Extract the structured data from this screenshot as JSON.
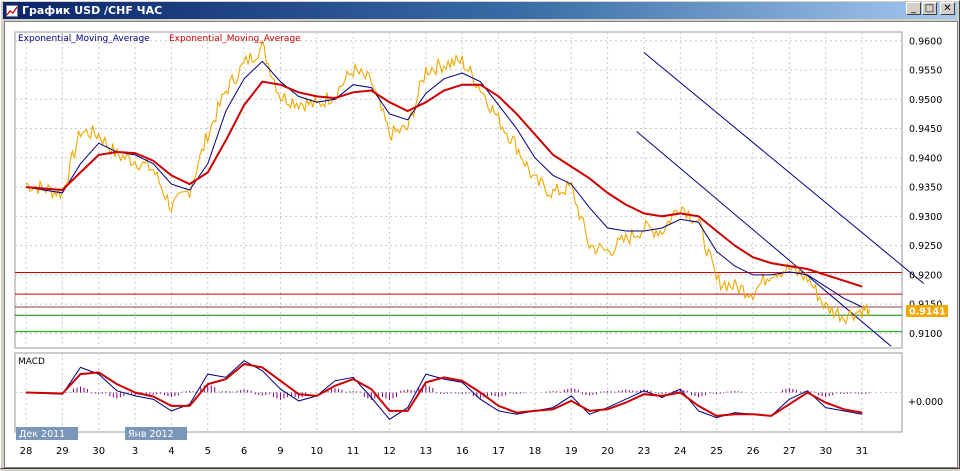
{
  "window": {
    "title": "График USD /CHF  ЧАС",
    "buttons": {
      "minimize": "_",
      "maximize": "□",
      "close": "✕"
    },
    "icon": "chart-window-icon"
  },
  "chart_data": {
    "type": "line",
    "title": "",
    "legend": [
      {
        "name": "Exponential_Moving_Average",
        "color": "#000080"
      },
      {
        "name": "Exponential_Moving_Average",
        "color": "#cc0000"
      }
    ],
    "price_axis": {
      "ticks": [
        "0.9600",
        "0.9550",
        "0.9500",
        "0.9450",
        "0.9400",
        "0.9350",
        "0.9300",
        "0.9250",
        "0.9200",
        "0.9150",
        "0.9100"
      ],
      "ylim": [
        0.9075,
        0.9615
      ],
      "current_price": "0.9141"
    },
    "date_axis": {
      "ticks": [
        "28",
        "29",
        "30",
        "3",
        "4",
        "5",
        "6",
        "9",
        "10",
        "11",
        "12",
        "13",
        "16",
        "17",
        "18",
        "19",
        "20",
        "23",
        "24",
        "25",
        "26",
        "27",
        "30",
        "31"
      ],
      "period_labels": [
        {
          "text": "Дек 2011",
          "at_tick": "28"
        },
        {
          "text": "Янв 2012",
          "at_tick": "3"
        }
      ]
    },
    "price_series": {
      "name": "USD/CHF",
      "color": "#f0a800",
      "x": [
        0,
        1,
        1.5,
        2,
        2.5,
        3,
        3.5,
        4,
        4.5,
        5,
        5.5,
        6,
        6.5,
        7,
        7.5,
        8,
        8.5,
        9,
        9.5,
        10,
        10.5,
        11,
        11.5,
        12,
        12.5,
        13,
        13.5,
        14,
        14.5,
        15,
        15.5,
        16,
        16.5,
        17,
        17.5,
        18,
        18.5,
        19,
        19.5,
        20,
        20.5,
        21,
        21.5,
        22,
        22.5,
        23,
        23.2
      ],
      "y": [
        0.9355,
        0.934,
        0.9445,
        0.944,
        0.9405,
        0.9395,
        0.938,
        0.9315,
        0.9345,
        0.944,
        0.9515,
        0.956,
        0.959,
        0.9505,
        0.9495,
        0.949,
        0.951,
        0.955,
        0.953,
        0.944,
        0.945,
        0.955,
        0.956,
        0.9565,
        0.952,
        0.9465,
        0.942,
        0.936,
        0.934,
        0.935,
        0.925,
        0.924,
        0.926,
        0.928,
        0.9275,
        0.932,
        0.929,
        0.919,
        0.918,
        0.917,
        0.9205,
        0.921,
        0.9195,
        0.9145,
        0.913,
        0.914,
        0.9141
      ]
    },
    "ema_fast": {
      "name": "Exponential_Moving_Average",
      "color": "#000080",
      "x": [
        0,
        1,
        1.5,
        2,
        2.5,
        3,
        3.5,
        4,
        4.5,
        5,
        5.5,
        6,
        6.5,
        7,
        7.5,
        8,
        8.5,
        9,
        9.5,
        10,
        10.5,
        11,
        11.5,
        12,
        12.5,
        13,
        13.5,
        14,
        14.5,
        15,
        15.5,
        16,
        16.5,
        17,
        17.5,
        18,
        18.5,
        19,
        19.5,
        20,
        20.5,
        21,
        21.5,
        22,
        22.5,
        23
      ],
      "y": [
        0.935,
        0.934,
        0.939,
        0.9425,
        0.941,
        0.9405,
        0.939,
        0.9355,
        0.9345,
        0.939,
        0.948,
        0.9535,
        0.9565,
        0.953,
        0.9505,
        0.9495,
        0.95,
        0.9525,
        0.952,
        0.9475,
        0.9465,
        0.951,
        0.9535,
        0.9545,
        0.953,
        0.949,
        0.945,
        0.94,
        0.937,
        0.9355,
        0.9315,
        0.928,
        0.9275,
        0.9275,
        0.928,
        0.9295,
        0.929,
        0.924,
        0.9215,
        0.92,
        0.92,
        0.9205,
        0.92,
        0.918,
        0.916,
        0.9145
      ]
    },
    "ema_slow": {
      "name": "Exponential_Moving_Average",
      "color": "#cc0000",
      "x": [
        0,
        1,
        1.5,
        2,
        2.5,
        3,
        3.5,
        4,
        4.5,
        5,
        5.5,
        6,
        6.5,
        7,
        7.5,
        8,
        8.5,
        9,
        9.5,
        10,
        10.5,
        11,
        11.5,
        12,
        12.5,
        13,
        13.5,
        14,
        14.5,
        15,
        15.5,
        16,
        16.5,
        17,
        17.5,
        18,
        18.5,
        19,
        19.5,
        20,
        20.5,
        21,
        21.5,
        22,
        22.5,
        23
      ],
      "y": [
        0.935,
        0.9345,
        0.9375,
        0.9405,
        0.941,
        0.9408,
        0.9395,
        0.937,
        0.9355,
        0.9375,
        0.943,
        0.949,
        0.953,
        0.9525,
        0.9512,
        0.9505,
        0.9502,
        0.9512,
        0.9515,
        0.9495,
        0.948,
        0.9495,
        0.9515,
        0.9525,
        0.9525,
        0.9505,
        0.9475,
        0.944,
        0.9405,
        0.9385,
        0.9365,
        0.934,
        0.932,
        0.9305,
        0.93,
        0.9305,
        0.93,
        0.9275,
        0.925,
        0.923,
        0.922,
        0.9215,
        0.921,
        0.92,
        0.919,
        0.918
      ]
    },
    "horizontal_levels": [
      {
        "value": 0.9204,
        "color": "#cc0000"
      },
      {
        "value": 0.9167,
        "color": "#cc0000"
      },
      {
        "value": 0.9145,
        "color": "#884444"
      },
      {
        "value": 0.9131,
        "color": "#008800"
      },
      {
        "value": 0.9103,
        "color": "#00aa00"
      }
    ],
    "channel_lines": [
      {
        "color": "#000080",
        "x": [
          17,
          24.7
        ],
        "y": [
          0.958,
          0.9185
        ]
      },
      {
        "color": "#000080",
        "x": [
          16.8,
          23.8
        ],
        "y": [
          0.9445,
          0.9078
        ]
      }
    ],
    "macd": {
      "label": "MACD",
      "zero_label": "+0.000",
      "ylim": [
        -1,
        1
      ],
      "x": [
        0,
        1,
        1.5,
        2,
        2.5,
        3,
        3.5,
        4,
        4.5,
        5,
        5.5,
        6,
        6.5,
        7,
        7.5,
        8,
        8.5,
        9,
        9.5,
        10,
        10.5,
        11,
        11.5,
        12,
        12.5,
        13,
        13.5,
        14,
        14.5,
        15,
        15.5,
        16,
        16.5,
        17,
        17.5,
        18,
        18.5,
        19,
        19.5,
        20,
        20.5,
        21,
        21.5,
        22,
        22.5,
        23
      ],
      "macd_line": [
        0.0,
        -0.05,
        0.75,
        0.55,
        0.05,
        -0.1,
        -0.2,
        -0.55,
        -0.35,
        0.55,
        0.45,
        0.95,
        0.65,
        0.1,
        -0.25,
        -0.1,
        0.35,
        0.45,
        -0.15,
        -0.8,
        -0.45,
        0.55,
        0.4,
        0.3,
        -0.2,
        -0.55,
        -0.65,
        -0.55,
        -0.45,
        -0.1,
        -0.65,
        -0.45,
        -0.2,
        0.05,
        -0.15,
        0.1,
        -0.55,
        -0.75,
        -0.6,
        -0.65,
        -0.7,
        -0.2,
        0.05,
        -0.45,
        -0.55,
        -0.65
      ],
      "signal_line": [
        0.0,
        -0.03,
        0.55,
        0.6,
        0.25,
        0.0,
        -0.12,
        -0.4,
        -0.4,
        0.25,
        0.4,
        0.85,
        0.75,
        0.35,
        -0.05,
        -0.1,
        0.2,
        0.4,
        0.1,
        -0.55,
        -0.55,
        0.3,
        0.45,
        0.35,
        0.0,
        -0.4,
        -0.6,
        -0.55,
        -0.5,
        -0.25,
        -0.55,
        -0.5,
        -0.3,
        -0.05,
        -0.1,
        0.0,
        -0.4,
        -0.7,
        -0.65,
        -0.65,
        -0.7,
        -0.35,
        0.0,
        -0.3,
        -0.5,
        -0.6
      ]
    }
  }
}
